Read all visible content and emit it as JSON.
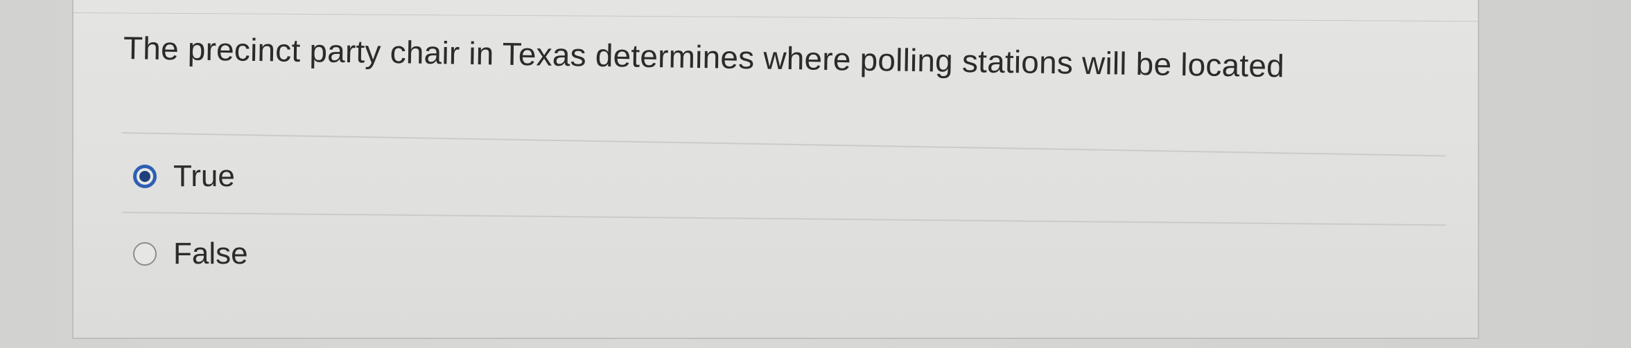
{
  "question": {
    "text": "The precinct party chair in Texas determines where polling stations will be located"
  },
  "options": [
    {
      "label": "True",
      "selected": true
    },
    {
      "label": "False",
      "selected": false
    }
  ],
  "colors": {
    "radio_selected_ring": "#2f5fb3",
    "radio_selected_dot": "#1f3f7a",
    "text": "#2b2b2b"
  }
}
